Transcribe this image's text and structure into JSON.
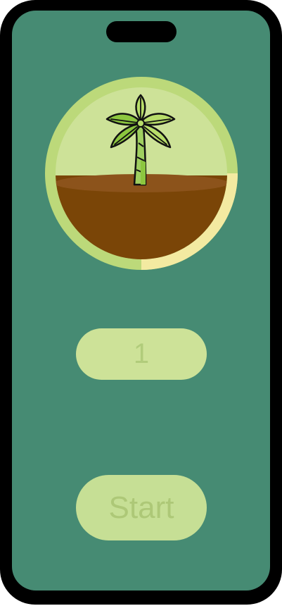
{
  "colors": {
    "screen_bg": "#468b73",
    "ring_outer": "#bcd97a",
    "ring_progress": "#f3eaa1",
    "circle_inner": "#cde298",
    "soil_dark": "#7a4507",
    "soil_light": "#8c531b",
    "pill_bg": "#cde298",
    "pill_text": "#b1cc7b",
    "button_bg": "#c6df95",
    "button_text": "#adc877",
    "tree_leaf": "#8cc63f",
    "tree_leaf_light": "#b8dd6a",
    "tree_trunk": "#9fcf60",
    "outline": "#111111"
  },
  "plant": {
    "icon": "palm-tree-icon",
    "progress": 0.25
  },
  "timer": {
    "value": "1"
  },
  "start_button": {
    "label": "Start"
  }
}
